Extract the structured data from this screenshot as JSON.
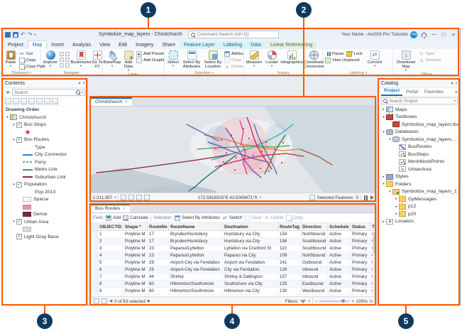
{
  "callouts": [
    "1",
    "2",
    "3",
    "4",
    "5"
  ],
  "titlebar": {
    "title": "Symbolize_map_layers - Christchurch",
    "command_search_placeholder": "Command Search (Alt+Q)",
    "account_name": "Your Name - ArcGIS Pro Tutorials",
    "account_initials": "YN"
  },
  "ribbon": {
    "tabs": [
      "Project",
      "Map",
      "Insert",
      "Analysis",
      "View",
      "Edit",
      "Imagery",
      "Share"
    ],
    "contextual_tabs": [
      "Feature Layer",
      "Labeling",
      "Data"
    ],
    "linear_tab": "Linear Referencing",
    "clipboard": {
      "label": "Clipboard",
      "paste": "Paste",
      "cut": "Cut",
      "copy": "Copy",
      "copy_path": "Copy Path"
    },
    "navigate": {
      "label": "Navigate",
      "explore": "Explore",
      "bookmarks": "Bookmarks",
      "go_to_xy": "Go To XY"
    },
    "layer": {
      "label": "Layer",
      "basemap": "Basemap",
      "add_data": "Add Data",
      "add_preset": "Add Preset",
      "add_graphics": "Add Graphics Layer"
    },
    "selection": {
      "label": "Selection",
      "select": "Select",
      "by_attributes": "Select By Attributes",
      "by_location": "Select By Location",
      "attributes": "Attributes",
      "clear": "Clear",
      "delete": "Delete"
    },
    "inquiry": {
      "label": "Inquiry",
      "measure": "Measure",
      "locate": "Locate",
      "infographics": "Infographics",
      "coordinate_conversion": "Coordinate Conversion"
    },
    "labeling": {
      "label": "Labeling",
      "pause": "Pause",
      "lock": "Lock",
      "view_unplaced": "View Unplaced",
      "convert": "Convert"
    },
    "offline": {
      "label": "Offline",
      "download_map": "Download Map",
      "sync": "Sync",
      "remove": "Remove"
    }
  },
  "contents": {
    "title": "Contents",
    "search_placeholder": "Search",
    "section_label": "Drawing Order",
    "tree": [
      {
        "indent": 0,
        "exp": "▾",
        "icon": "map",
        "label": "Christchurch"
      },
      {
        "indent": 1,
        "exp": "▾",
        "check": true,
        "label": "Bus Stops"
      },
      {
        "indent": 2,
        "swatch": "dot-pink"
      },
      {
        "indent": 1,
        "exp": "▾",
        "check": true,
        "label": "Bus Routes"
      },
      {
        "indent": 2,
        "swatch": "none",
        "label": "Type"
      },
      {
        "indent": 2,
        "swatch": "line-blue",
        "label": "City Connector"
      },
      {
        "indent": 2,
        "swatch": "line-dash",
        "label": "Ferry"
      },
      {
        "indent": 2,
        "swatch": "line-green",
        "label": "Metro Link"
      },
      {
        "indent": 2,
        "swatch": "line-maroon",
        "label": "Suburban Link"
      },
      {
        "indent": 1,
        "exp": "▾",
        "check": true,
        "label": "Population"
      },
      {
        "indent": 2,
        "swatch": "none",
        "label": "Pop 2013"
      },
      {
        "indent": 2,
        "swatch": "fill-light",
        "label": "Sparse"
      },
      {
        "indent": 2,
        "swatch": "fill-mid"
      },
      {
        "indent": 2,
        "swatch": "fill-dark",
        "label": "Dense"
      },
      {
        "indent": 1,
        "exp": "▾",
        "check": true,
        "label": "Urban Area"
      },
      {
        "indent": 2,
        "swatch": "fill-gray"
      },
      {
        "indent": 1,
        "check": true,
        "label": "Light Gray Base"
      }
    ]
  },
  "mapview": {
    "tab": "Christchurch",
    "scale": "1:211,357",
    "coordinates": "172.5819315°E 43.5009471°S",
    "selected_label": "Selected Features:",
    "selected_count": "0"
  },
  "table": {
    "tab": "Bus Routes",
    "toolbar": {
      "field_label": "Field:",
      "add": "Add",
      "calculate": "Calculate",
      "selection_label": "Selection:",
      "select_by_attributes": "Select By Attributes",
      "switch": "Switch",
      "clear": "Clear",
      "delete": "Delete",
      "copy": "Copy"
    },
    "columns": [
      "OBJECTID *",
      "Shape *",
      "RouteNo",
      "RouteName",
      "Destination",
      "RouteTag",
      "Direction",
      "Schedule",
      "Status",
      "Ty"
    ],
    "rows": [
      [
        "1",
        "Polyline M",
        "17",
        "Bryndwr/Huntsbury",
        "Huntsbury via City",
        "154",
        "Northbound",
        "Active",
        "Primary",
        "Ci"
      ],
      [
        "2",
        "Polyline M",
        "17",
        "Bryndwr/Huntsbury",
        "Huntsbury via City",
        "158",
        "Southbound",
        "Active",
        "Primary",
        "Ci"
      ],
      [
        "3",
        "Polyline M",
        "23",
        "Papanui/Lyttelton",
        "Lyttelton via Cranford St",
        "110",
        "Southbound",
        "Active",
        "Primary",
        "Ci"
      ],
      [
        "4",
        "Polyline M",
        "23",
        "Papanui/Lyttelton",
        "Papanui via City",
        "109",
        "Northbound",
        "Active",
        "Primary",
        "Ci"
      ],
      [
        "5",
        "Polyline M",
        "29",
        "Airport-City via Fendalton",
        "Airport via Fendalton",
        "141",
        "Outbound",
        "Active",
        "Primary",
        "Ci"
      ],
      [
        "6",
        "Polyline M",
        "29",
        "Airport-City via Fendalton",
        "City via Fendalton",
        "139",
        "Inbound",
        "Active",
        "Primary",
        "Ci"
      ],
      [
        "7",
        "Polyline M",
        "44",
        "Shirley",
        "Shirley & Dallington",
        "157",
        "Inbound",
        "Active",
        "Primary",
        "Ci"
      ],
      [
        "8",
        "Polyline M",
        "60",
        "Hillmorton/Southshore",
        "Southshore via City",
        "125",
        "Eastbound",
        "Active",
        "Primary",
        "Ci"
      ],
      [
        "9",
        "Polyline M",
        "60",
        "Hillmorton/Southshore",
        "Hillmorton via City",
        "130",
        "Westbound",
        "Active",
        "Primary",
        "Ci"
      ]
    ],
    "status": {
      "summary": "0 of 63 selected",
      "filters_label": "Filters:",
      "zoom": "100%"
    }
  },
  "catalog": {
    "title": "Catalog",
    "tabs": [
      "Project",
      "Portal",
      "Favorites"
    ],
    "search_placeholder": "Search Project",
    "tree": [
      {
        "indent": 0,
        "exp": "▸",
        "icon": "maps",
        "label": "Maps"
      },
      {
        "indent": 0,
        "exp": "▾",
        "icon": "toolbox",
        "label": "Toolboxes"
      },
      {
        "indent": 1,
        "icon": "tbx",
        "label": "Symbolize_map_layers.tbx"
      },
      {
        "indent": 0,
        "exp": "▾",
        "icon": "databases",
        "label": "Databases"
      },
      {
        "indent": 1,
        "exp": "▾",
        "icon": "gdb",
        "label": "Symbolize_map_layers.gdb"
      },
      {
        "indent": 2,
        "icon": "fc-line",
        "label": "BusRoutes"
      },
      {
        "indent": 2,
        "icon": "fc-point",
        "label": "BusStops"
      },
      {
        "indent": 2,
        "icon": "fc-point",
        "label": "MeshblockPoints"
      },
      {
        "indent": 2,
        "icon": "fc-poly",
        "label": "UrbanArea"
      },
      {
        "indent": 0,
        "exp": "▸",
        "icon": "styles",
        "label": "Styles"
      },
      {
        "indent": 0,
        "exp": "▾",
        "icon": "folder",
        "label": "Folders"
      },
      {
        "indent": 1,
        "exp": "▾",
        "icon": "folder-conn",
        "label": "Symbolize_map_layers_1"
      },
      {
        "indent": 2,
        "exp": "▸",
        "icon": "folder",
        "label": "GpMessages"
      },
      {
        "indent": 2,
        "exp": "▸",
        "icon": "folder",
        "label": "p12"
      },
      {
        "indent": 2,
        "exp": "▸",
        "icon": "folder",
        "label": "p20"
      },
      {
        "indent": 0,
        "exp": "▸",
        "icon": "locators",
        "label": "Locators"
      }
    ]
  }
}
